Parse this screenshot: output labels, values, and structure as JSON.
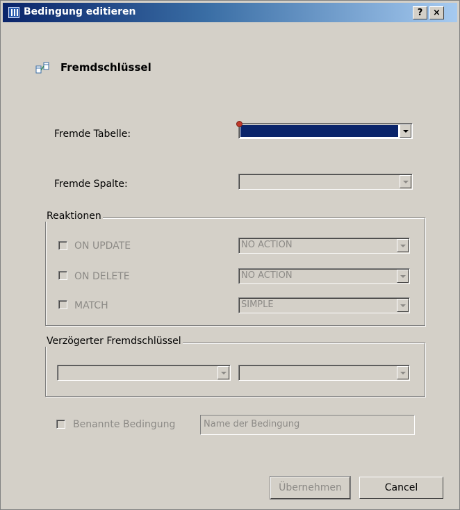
{
  "window": {
    "title": "Bedingung editieren",
    "help_label": "?",
    "close_label": "×"
  },
  "header": {
    "title": "Fremdschlüssel",
    "icon": "foreign-key-icon"
  },
  "fields": {
    "foreign_table": {
      "label": "Fremde Tabelle:",
      "value": ""
    },
    "foreign_column": {
      "label": "Fremde Spalte:",
      "value": ""
    }
  },
  "reactions": {
    "legend": "Reaktionen",
    "items": [
      {
        "label": "ON UPDATE",
        "value": "NO ACTION"
      },
      {
        "label": "ON DELETE",
        "value": "NO ACTION"
      },
      {
        "label": "MATCH",
        "value": "SIMPLE"
      }
    ]
  },
  "deferred": {
    "legend": "Verzögerter Fremdschlüssel",
    "value1": "",
    "value2": ""
  },
  "named": {
    "label": "Benannte Bedingung",
    "placeholder": "Name der Bedingung"
  },
  "buttons": {
    "apply": "Übernehmen",
    "cancel": "Cancel"
  }
}
